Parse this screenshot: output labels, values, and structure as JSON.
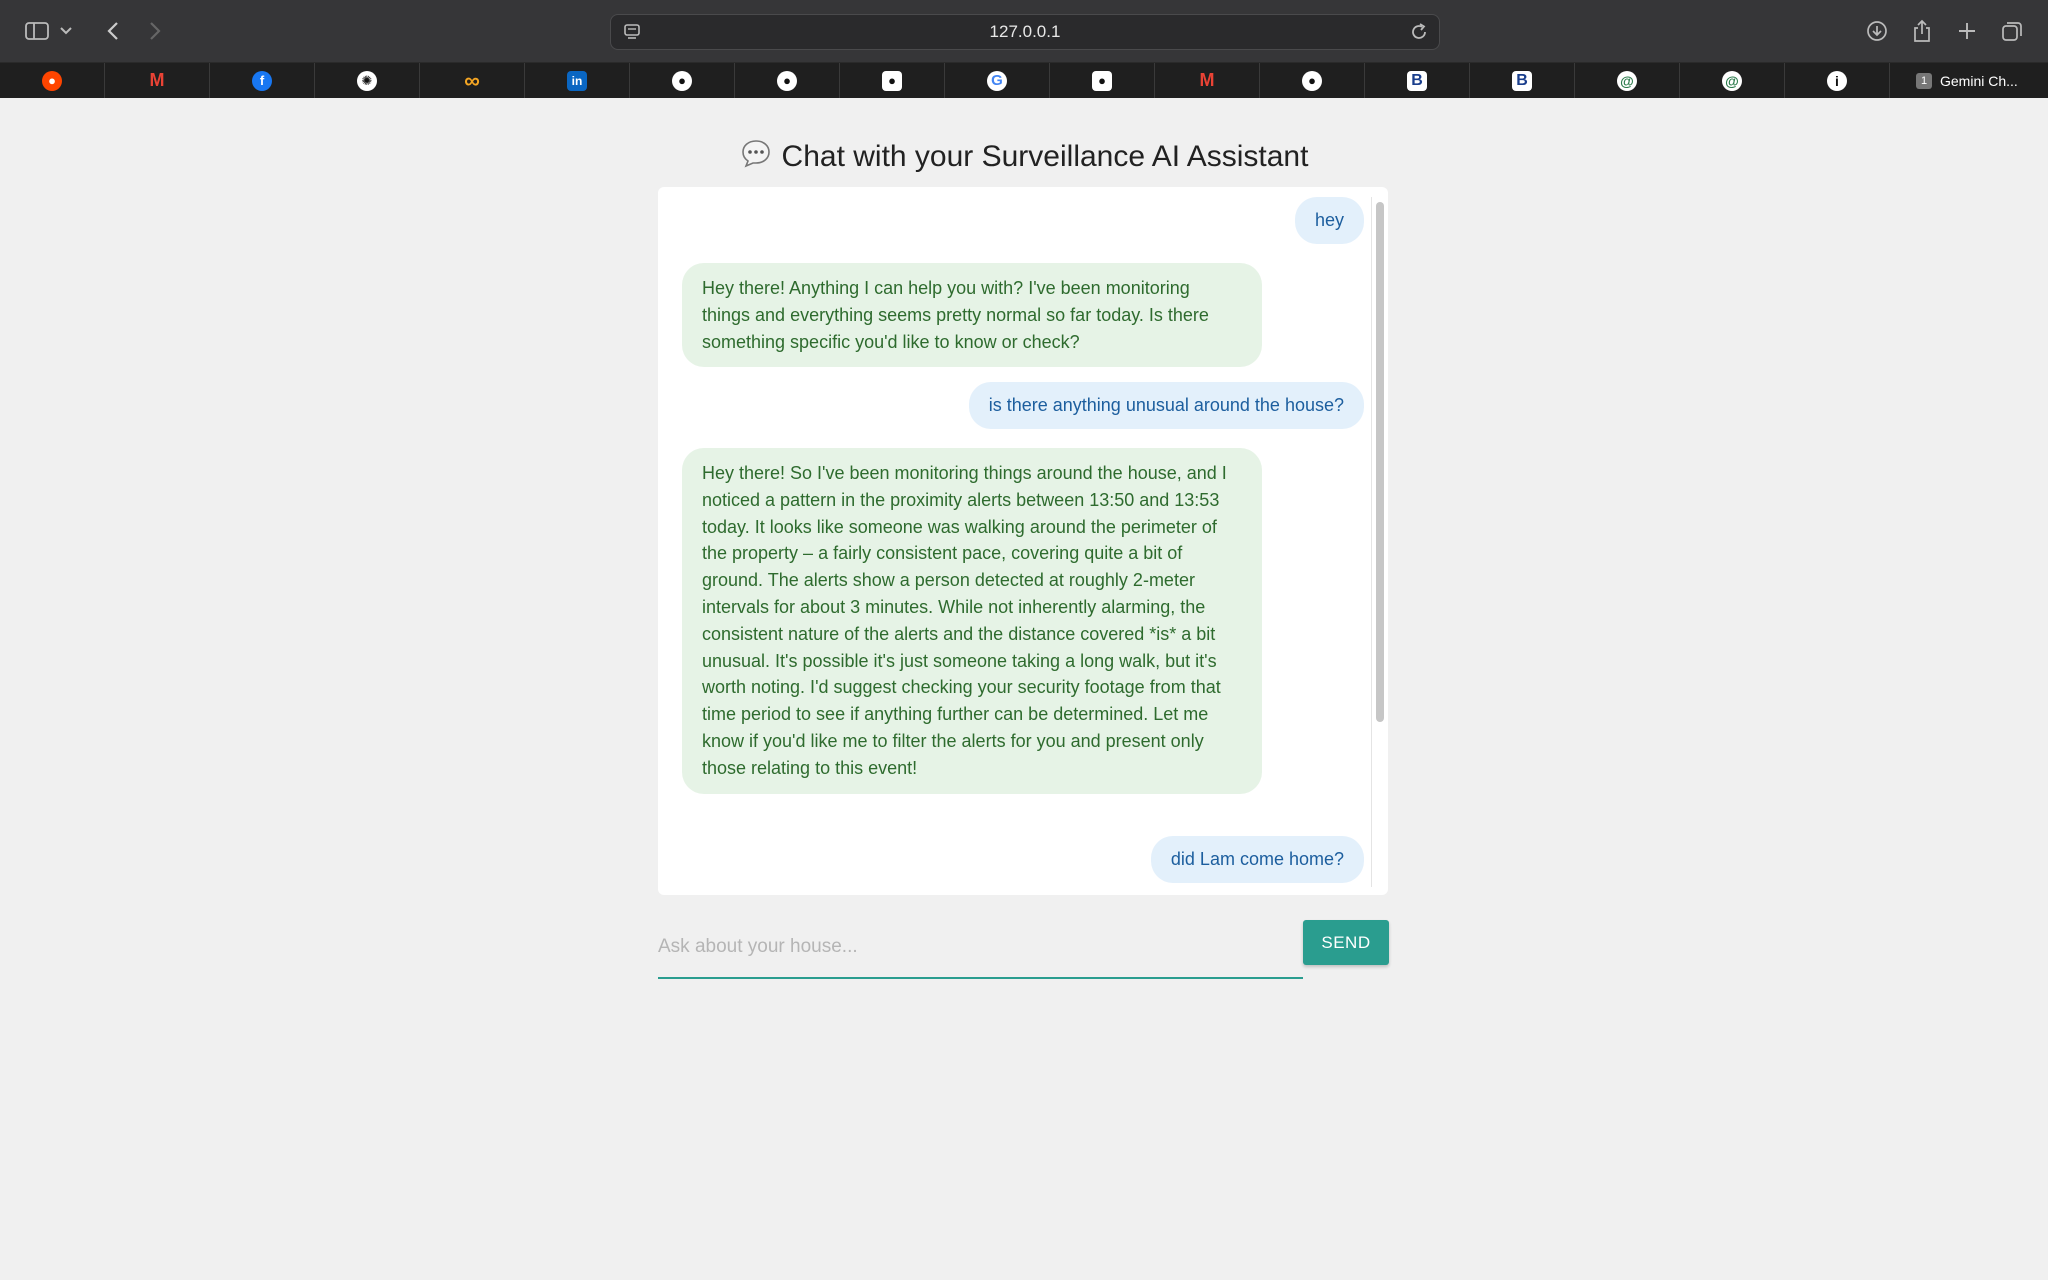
{
  "browser": {
    "address": "127.0.0.1",
    "bookmarks": [
      {
        "icon": "reddit-icon"
      },
      {
        "icon": "gmail-icon"
      },
      {
        "icon": "facebook-icon"
      },
      {
        "icon": "chatgpt-icon"
      },
      {
        "icon": "infinity-icon"
      },
      {
        "icon": "linkedin-icon"
      },
      {
        "icon": "github-icon"
      },
      {
        "icon": "github-icon"
      },
      {
        "icon": "github-alt-icon"
      },
      {
        "icon": "google-icon"
      },
      {
        "icon": "github-alt-icon"
      },
      {
        "icon": "gmail-icon"
      },
      {
        "icon": "github-icon"
      },
      {
        "icon": "b-icon"
      },
      {
        "icon": "b-icon"
      },
      {
        "icon": "swirl-icon"
      },
      {
        "icon": "swirl-icon"
      },
      {
        "icon": "info-icon"
      }
    ],
    "last_tab": {
      "badge": "1",
      "label": "Gemini Ch..."
    }
  },
  "page": {
    "title": "Chat with your Surveillance AI Assistant",
    "title_icon": "speech-bubble-icon"
  },
  "messages": [
    {
      "role": "user",
      "text": "hey"
    },
    {
      "role": "assistant",
      "text": "Hey there! Anything I can help you with? I've been monitoring things and everything seems pretty normal so far today. Is there something specific you'd like to know or check?"
    },
    {
      "role": "user",
      "text": "is there anything unusual around the house?"
    },
    {
      "role": "assistant",
      "text": "Hey there! So I've been monitoring things around the house, and I noticed a pattern in the proximity alerts between 13:50 and 13:53 today. It looks like someone was walking around the perimeter of the property – a fairly consistent pace, covering quite a bit of ground. The alerts show a person detected at roughly 2-meter intervals for about 3 minutes. While not inherently alarming, the consistent nature of the alerts and the distance covered *is* a bit unusual. It's possible it's just someone taking a long walk, but it's worth noting. I'd suggest checking your security footage from that time period to see if anything further can be determined. Let me know if you'd like me to filter the alerts for you and present only those relating to this event!"
    },
    {
      "role": "user",
      "text": "did Lam come home?"
    }
  ],
  "composer": {
    "placeholder": "Ask about your house...",
    "value": "",
    "send_label": "SEND"
  },
  "colors": {
    "accent": "#2a9d8f",
    "user_bubble": "#e3f0fb",
    "assistant_bubble": "#e6f3e6"
  }
}
